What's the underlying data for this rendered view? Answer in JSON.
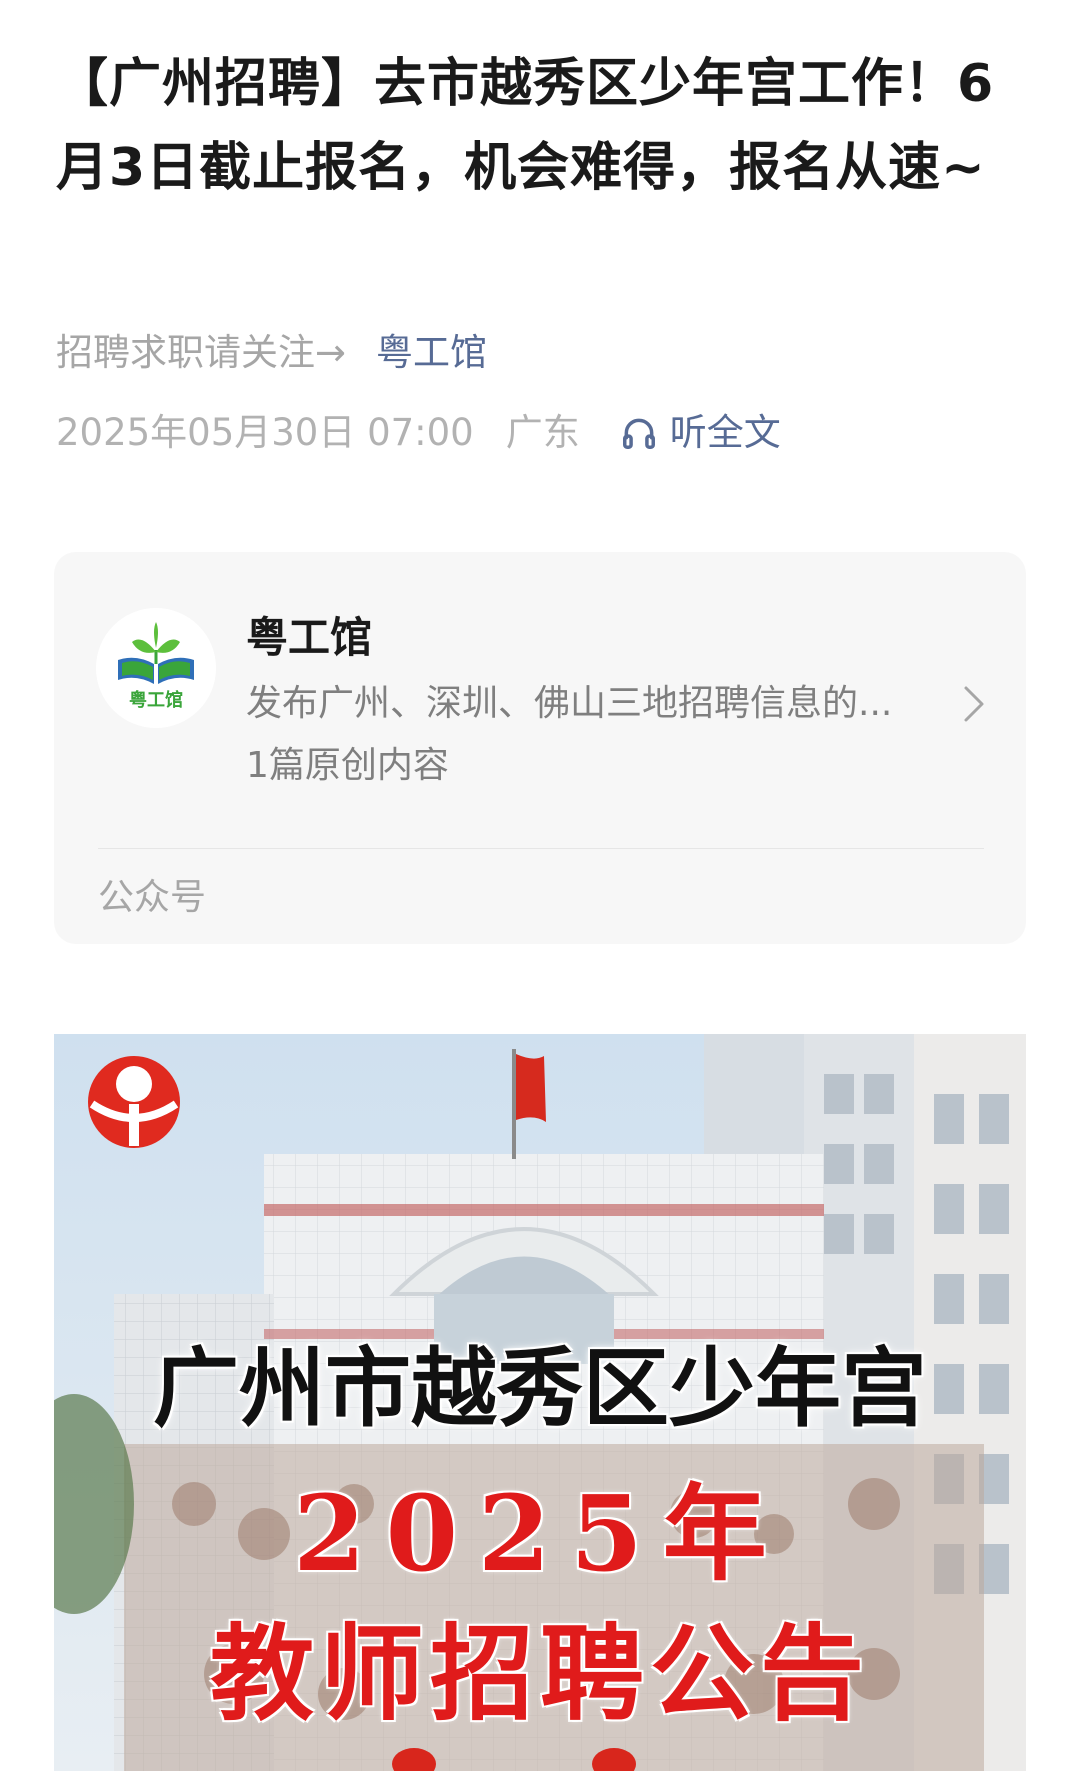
{
  "article": {
    "title": "【广州招聘】去市越秀区少年宫工作！6月3日截止报名，机会难得，报名从速~",
    "follow_prefix": "招聘求职请关注→",
    "follow_account": "粤工馆",
    "date": "2025年05月30日 07:00",
    "location": "广东",
    "listen_label": "听全文",
    "listen_icon": "headphones-icon"
  },
  "account_card": {
    "name": "粤工馆",
    "logo_text": "粤工馆",
    "description": "发布广州、深圳、佛山三地招聘信息的...",
    "count": "1篇原创内容",
    "type_label": "公众号",
    "chevron_icon": "chevron-right-icon"
  },
  "cover": {
    "title_line": "广州市越秀区少年宫",
    "year_line": "2025年",
    "notice_line": "教师招聘公告"
  },
  "colors": {
    "link": "#576b95",
    "meta": "#b2b2b2",
    "cover_red": "#e01b1b",
    "card_bg": "#f7f7f7",
    "logo_green": "#3aa53a"
  }
}
